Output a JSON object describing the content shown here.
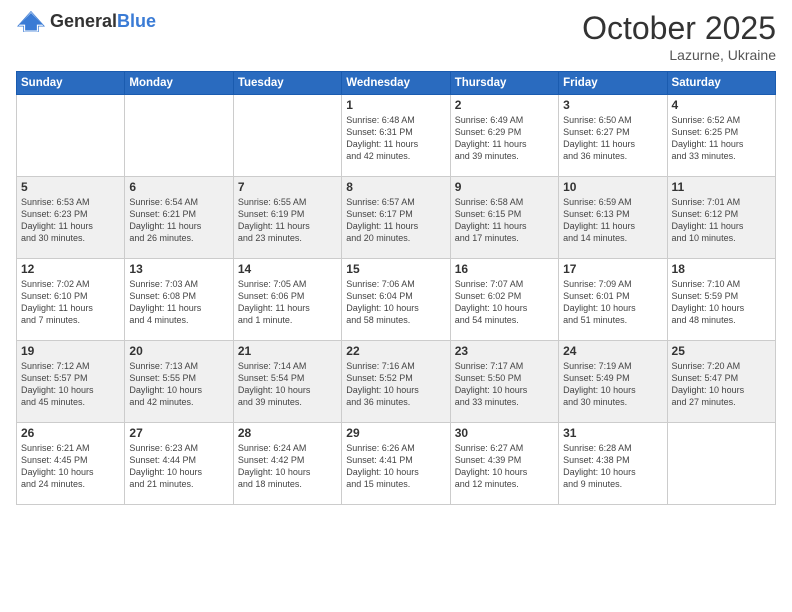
{
  "header": {
    "logo_general": "General",
    "logo_blue": "Blue",
    "month": "October 2025",
    "location": "Lazurne, Ukraine"
  },
  "weekdays": [
    "Sunday",
    "Monday",
    "Tuesday",
    "Wednesday",
    "Thursday",
    "Friday",
    "Saturday"
  ],
  "weeks": [
    [
      {
        "day": "",
        "info": ""
      },
      {
        "day": "",
        "info": ""
      },
      {
        "day": "",
        "info": ""
      },
      {
        "day": "1",
        "info": "Sunrise: 6:48 AM\nSunset: 6:31 PM\nDaylight: 11 hours\nand 42 minutes."
      },
      {
        "day": "2",
        "info": "Sunrise: 6:49 AM\nSunset: 6:29 PM\nDaylight: 11 hours\nand 39 minutes."
      },
      {
        "day": "3",
        "info": "Sunrise: 6:50 AM\nSunset: 6:27 PM\nDaylight: 11 hours\nand 36 minutes."
      },
      {
        "day": "4",
        "info": "Sunrise: 6:52 AM\nSunset: 6:25 PM\nDaylight: 11 hours\nand 33 minutes."
      }
    ],
    [
      {
        "day": "5",
        "info": "Sunrise: 6:53 AM\nSunset: 6:23 PM\nDaylight: 11 hours\nand 30 minutes."
      },
      {
        "day": "6",
        "info": "Sunrise: 6:54 AM\nSunset: 6:21 PM\nDaylight: 11 hours\nand 26 minutes."
      },
      {
        "day": "7",
        "info": "Sunrise: 6:55 AM\nSunset: 6:19 PM\nDaylight: 11 hours\nand 23 minutes."
      },
      {
        "day": "8",
        "info": "Sunrise: 6:57 AM\nSunset: 6:17 PM\nDaylight: 11 hours\nand 20 minutes."
      },
      {
        "day": "9",
        "info": "Sunrise: 6:58 AM\nSunset: 6:15 PM\nDaylight: 11 hours\nand 17 minutes."
      },
      {
        "day": "10",
        "info": "Sunrise: 6:59 AM\nSunset: 6:13 PM\nDaylight: 11 hours\nand 14 minutes."
      },
      {
        "day": "11",
        "info": "Sunrise: 7:01 AM\nSunset: 6:12 PM\nDaylight: 11 hours\nand 10 minutes."
      }
    ],
    [
      {
        "day": "12",
        "info": "Sunrise: 7:02 AM\nSunset: 6:10 PM\nDaylight: 11 hours\nand 7 minutes."
      },
      {
        "day": "13",
        "info": "Sunrise: 7:03 AM\nSunset: 6:08 PM\nDaylight: 11 hours\nand 4 minutes."
      },
      {
        "day": "14",
        "info": "Sunrise: 7:05 AM\nSunset: 6:06 PM\nDaylight: 11 hours\nand 1 minute."
      },
      {
        "day": "15",
        "info": "Sunrise: 7:06 AM\nSunset: 6:04 PM\nDaylight: 10 hours\nand 58 minutes."
      },
      {
        "day": "16",
        "info": "Sunrise: 7:07 AM\nSunset: 6:02 PM\nDaylight: 10 hours\nand 54 minutes."
      },
      {
        "day": "17",
        "info": "Sunrise: 7:09 AM\nSunset: 6:01 PM\nDaylight: 10 hours\nand 51 minutes."
      },
      {
        "day": "18",
        "info": "Sunrise: 7:10 AM\nSunset: 5:59 PM\nDaylight: 10 hours\nand 48 minutes."
      }
    ],
    [
      {
        "day": "19",
        "info": "Sunrise: 7:12 AM\nSunset: 5:57 PM\nDaylight: 10 hours\nand 45 minutes."
      },
      {
        "day": "20",
        "info": "Sunrise: 7:13 AM\nSunset: 5:55 PM\nDaylight: 10 hours\nand 42 minutes."
      },
      {
        "day": "21",
        "info": "Sunrise: 7:14 AM\nSunset: 5:54 PM\nDaylight: 10 hours\nand 39 minutes."
      },
      {
        "day": "22",
        "info": "Sunrise: 7:16 AM\nSunset: 5:52 PM\nDaylight: 10 hours\nand 36 minutes."
      },
      {
        "day": "23",
        "info": "Sunrise: 7:17 AM\nSunset: 5:50 PM\nDaylight: 10 hours\nand 33 minutes."
      },
      {
        "day": "24",
        "info": "Sunrise: 7:19 AM\nSunset: 5:49 PM\nDaylight: 10 hours\nand 30 minutes."
      },
      {
        "day": "25",
        "info": "Sunrise: 7:20 AM\nSunset: 5:47 PM\nDaylight: 10 hours\nand 27 minutes."
      }
    ],
    [
      {
        "day": "26",
        "info": "Sunrise: 6:21 AM\nSunset: 4:45 PM\nDaylight: 10 hours\nand 24 minutes."
      },
      {
        "day": "27",
        "info": "Sunrise: 6:23 AM\nSunset: 4:44 PM\nDaylight: 10 hours\nand 21 minutes."
      },
      {
        "day": "28",
        "info": "Sunrise: 6:24 AM\nSunset: 4:42 PM\nDaylight: 10 hours\nand 18 minutes."
      },
      {
        "day": "29",
        "info": "Sunrise: 6:26 AM\nSunset: 4:41 PM\nDaylight: 10 hours\nand 15 minutes."
      },
      {
        "day": "30",
        "info": "Sunrise: 6:27 AM\nSunset: 4:39 PM\nDaylight: 10 hours\nand 12 minutes."
      },
      {
        "day": "31",
        "info": "Sunrise: 6:28 AM\nSunset: 4:38 PM\nDaylight: 10 hours\nand 9 minutes."
      },
      {
        "day": "",
        "info": ""
      }
    ]
  ]
}
